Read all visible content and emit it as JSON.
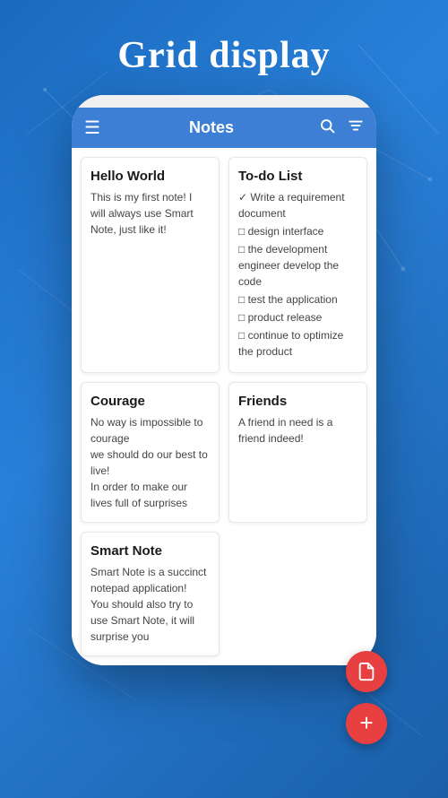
{
  "page": {
    "title": "Grid display",
    "background_color": "#2176c7"
  },
  "app_bar": {
    "title": "Notes",
    "menu_icon": "☰",
    "search_icon": "🔍",
    "filter_icon": "⚌"
  },
  "notes": [
    {
      "id": "hello-world",
      "title": "Hello World",
      "body": "This is my first note! I will always use Smart Note, just like it!",
      "type": "text"
    },
    {
      "id": "todo-list",
      "title": "To-do List",
      "type": "checklist",
      "items": [
        {
          "checked": true,
          "text": "Write a requirement document"
        },
        {
          "checked": false,
          "text": "design interface"
        },
        {
          "checked": false,
          "text": "the development engineer develop the code"
        },
        {
          "checked": false,
          "text": "test the application"
        },
        {
          "checked": false,
          "text": "product release"
        },
        {
          "checked": false,
          "text": "continue to optimize the product"
        }
      ]
    },
    {
      "id": "courage",
      "title": "Courage",
      "body": "No way is impossible to courage\nwe should do our best to live!\nIn order to make our lives full of surprises",
      "type": "text"
    },
    {
      "id": "friends",
      "title": "Friends",
      "body": "A friend in need is a friend indeed!",
      "type": "text"
    },
    {
      "id": "smart-note",
      "title": "Smart Note",
      "body": "Smart Note is a succinct notepad application!\nYou should also try to use Smart Note, it will surprise you",
      "type": "text",
      "span": "full-left"
    }
  ],
  "fab": {
    "doc_icon": "📄",
    "add_icon": "+"
  }
}
